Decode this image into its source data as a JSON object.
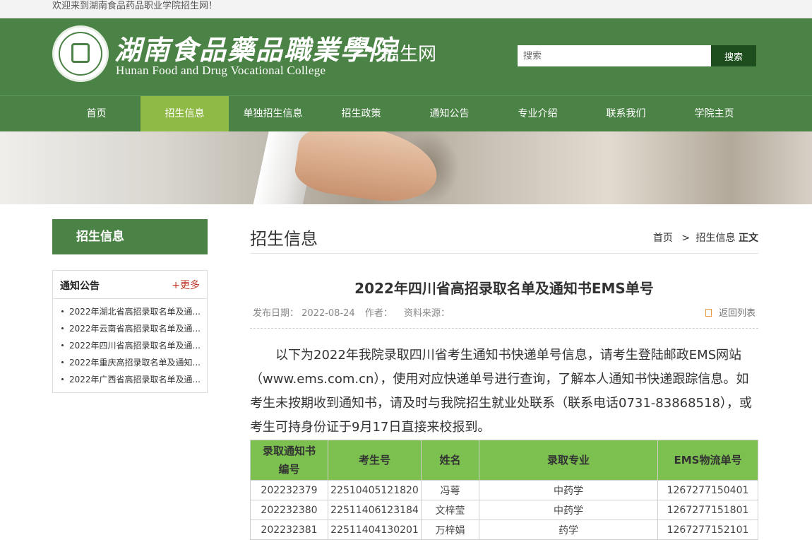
{
  "topbar": {
    "welcome": "欢迎来到湖南食品药品职业学院招生网！"
  },
  "header": {
    "logo_cn": "湖南食品藥品職業學院",
    "logo_suffix": "招生网",
    "logo_en": "Hunan Food and Drug Vocational College",
    "search_placeholder": "搜索",
    "search_button": "搜索"
  },
  "nav": [
    {
      "label": "首页"
    },
    {
      "label": "招生信息"
    },
    {
      "label": "单独招生信息"
    },
    {
      "label": "招生政策"
    },
    {
      "label": "通知公告"
    },
    {
      "label": "专业介绍"
    },
    {
      "label": "联系我们"
    },
    {
      "label": "学院主页"
    }
  ],
  "sidebar": {
    "title": "招生信息",
    "notice_title": "通知公告",
    "more": "+更多",
    "items": [
      {
        "text": "2022年湖北省高招录取名单及通..."
      },
      {
        "text": "2022年云南省高招录取名单及通..."
      },
      {
        "text": "2022年四川省高招录取名单及通..."
      },
      {
        "text": "2022年重庆高招录取名单及通知..."
      },
      {
        "text": "2022年广西省高招录取名单及通..."
      }
    ]
  },
  "main": {
    "section_title": "招生信息",
    "breadcrumb": {
      "home": "首页",
      "sep": ">",
      "section": "招生信息",
      "current": "正文"
    },
    "article_title": "2022年四川省高招录取名单及通知书EMS单号",
    "meta": {
      "date": "发布日期： 2022-08-24",
      "author": "作者：",
      "source": "资料来源："
    },
    "back": "返回列表",
    "body": "以下为2022年我院录取四川省考生通知书快递单号信息，请考生登陆邮政EMS网站（www.ems.com.cn），使用对应快递单号进行查询，了解本人通知书快递跟踪信息。如考生未按期收到通知书，请及时与我院招生就业处联系（联系电话0731-83868518），或考生可持身份证于9月17日直接来校报到。",
    "table": {
      "headers": [
        "录取通知书编号",
        "考生号",
        "姓名",
        "录取专业",
        "EMS物流单号"
      ],
      "rows": [
        [
          "202232379",
          "22510405121820",
          "冯萼",
          "中药学",
          "1267277150401"
        ],
        [
          "202232380",
          "22511406123184",
          "文梓莹",
          "中药学",
          "1267277151801"
        ],
        [
          "202232381",
          "22511404130201",
          "万梓娟",
          "药学",
          "1267277152101"
        ]
      ]
    }
  },
  "colors": {
    "green": "#4b8245",
    "nav_active": "#8fba45",
    "table_head": "#7cc04f",
    "search_btn": "#1e4d1e"
  }
}
